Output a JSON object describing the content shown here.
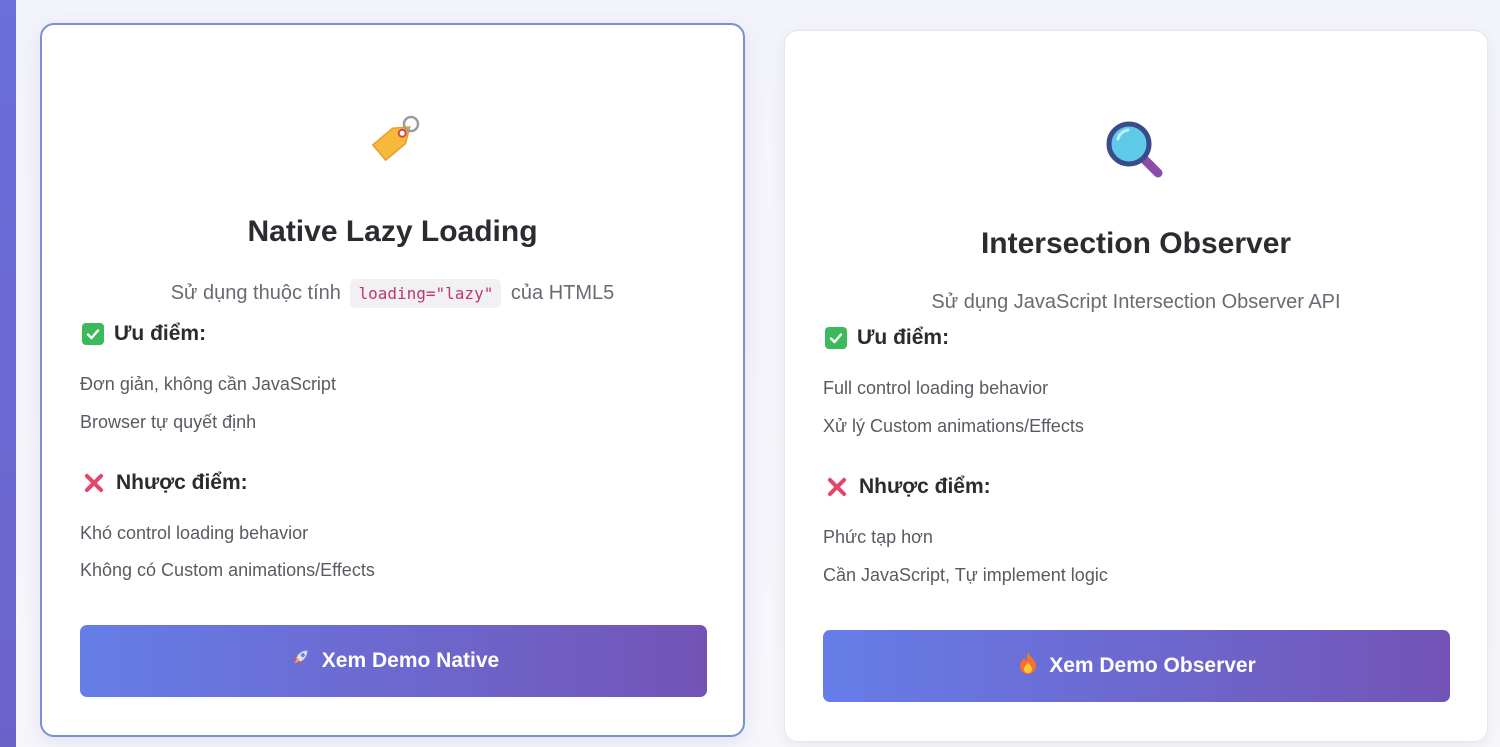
{
  "cards": [
    {
      "icon": "tag-icon",
      "title": "Native Lazy Loading",
      "desc_before": "Sử dụng thuộc tính",
      "desc_code": "loading=\"lazy\"",
      "desc_after": "của HTML5",
      "pros_heading": "Ưu điểm:",
      "pros": [
        "Đơn giản, không cần JavaScript",
        "Browser tự quyết định"
      ],
      "cons_heading": "Nhược điểm:",
      "cons": [
        "Khó control loading behavior",
        "Không có Custom animations/Effects"
      ],
      "button_label": "Xem Demo Native",
      "button_icon": "rocket-icon"
    },
    {
      "icon": "magnifier-icon",
      "title": "Intersection Observer",
      "desc": "Sử dụng JavaScript Intersection Observer API",
      "pros_heading": "Ưu điểm:",
      "pros": [
        "Full control loading behavior",
        "Xử lý Custom animations/Effects"
      ],
      "cons_heading": "Nhược điểm:",
      "cons": [
        "Phức tạp hơn",
        "Cần JavaScript, Tự implement logic"
      ],
      "button_label": "Xem Demo Observer",
      "button_icon": "fire-icon"
    }
  ],
  "colors": {
    "button_gradient_start": "#667de8",
    "button_gradient_end": "#7354b6",
    "check": "#3cb95b",
    "cross": "#e6456c",
    "code_text": "#c2366b"
  }
}
